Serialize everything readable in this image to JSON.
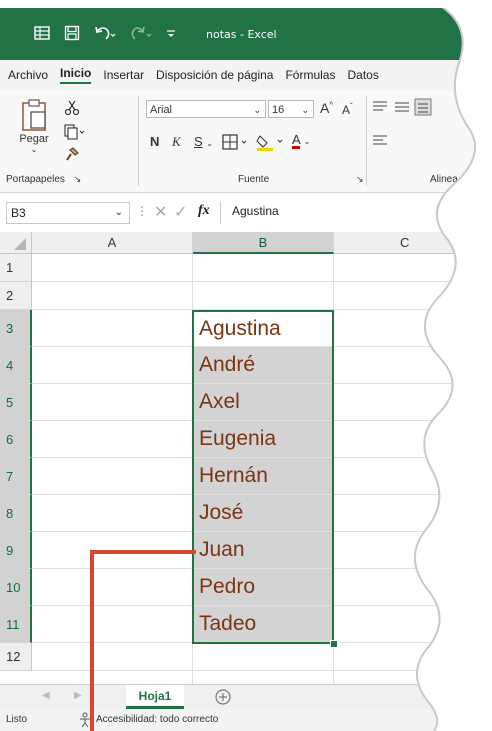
{
  "titlebar": {
    "title": "notas - Excel",
    "excel_icon": "excel-grid-icon",
    "save_icon": "save-icon",
    "undo_icon": "undo-icon",
    "redo_icon": "redo-icon",
    "customize_icon": "customize-qat-icon"
  },
  "tabs": [
    "Archivo",
    "Inicio",
    "Insertar",
    "Disposición de página",
    "Fórmulas",
    "Datos"
  ],
  "ribbon": {
    "paste_label": "Pegar",
    "clipboard_group": "Portapapeles",
    "font_name": "Arial",
    "font_size": "16",
    "font_group": "Fuente",
    "align_group": "Alinea",
    "bold": "N",
    "italic": "K",
    "underline": "S",
    "grow_font": "A",
    "shrink_font": "A",
    "font_color": "A"
  },
  "formula_bar": {
    "name_box": "B3",
    "fx_label": "fx",
    "content": "Agustina"
  },
  "columns": [
    "A",
    "B",
    "C"
  ],
  "rows": [
    "1",
    "2",
    "3",
    "4",
    "5",
    "6",
    "7",
    "8",
    "9",
    "10",
    "11",
    "12"
  ],
  "cells_B": [
    "Agustina",
    "André",
    "Axel",
    "Eugenia",
    "Hernán",
    "José",
    "Juan",
    "Pedro",
    "Tadeo"
  ],
  "sheet_tabs": {
    "active": "Hoja1",
    "add_icon": "plus-circle-icon"
  },
  "status": {
    "ready": "Listo",
    "accessibility": "Accesibilidad: todo correcto"
  },
  "colors": {
    "excel_green": "#217346",
    "text_brown": "#7a3411",
    "selection_gray": "#d3d3d3",
    "annotation_red": "#d9472b"
  }
}
